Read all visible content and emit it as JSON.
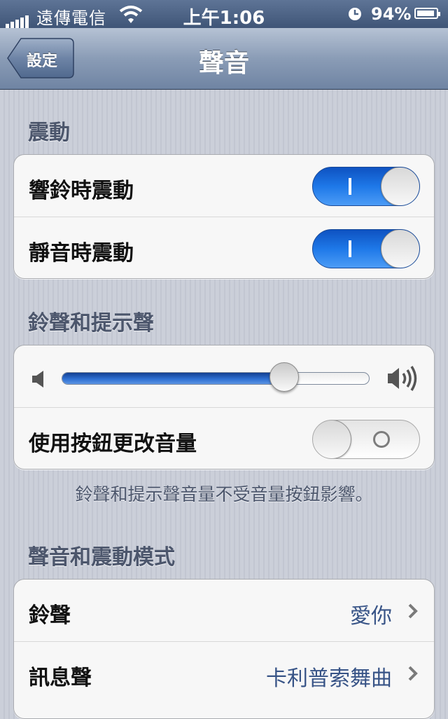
{
  "status_bar": {
    "carrier": "遠傳電信",
    "time": "上午1:06",
    "battery_percent": "94%",
    "battery_level": 0.94,
    "signal_bars": 5,
    "icons": [
      "signal-icon",
      "wifi-icon",
      "alarm-icon",
      "battery-icon"
    ]
  },
  "nav": {
    "back_label": "設定",
    "title": "聲音"
  },
  "sections": {
    "vibration": {
      "header": "震動",
      "rows": [
        {
          "label": "響鈴時震動",
          "on": true
        },
        {
          "label": "靜音時震動",
          "on": true
        }
      ]
    },
    "ringer": {
      "header": "鈴聲和提示聲",
      "volume": 0.72,
      "change_with_buttons_label": "使用按鈕更改音量",
      "change_with_buttons_on": false,
      "footer": "鈴聲和提示聲音量不受音量按鈕影響。"
    },
    "patterns": {
      "header": "聲音和震動模式",
      "rows": [
        {
          "label": "鈴聲",
          "value": "愛你"
        },
        {
          "label": "訊息聲",
          "value": "卡利普索舞曲"
        }
      ]
    }
  },
  "colors": {
    "switch_on": "#1e78e8",
    "value_text": "#385487",
    "nav_bar": "#8a9cb6"
  }
}
